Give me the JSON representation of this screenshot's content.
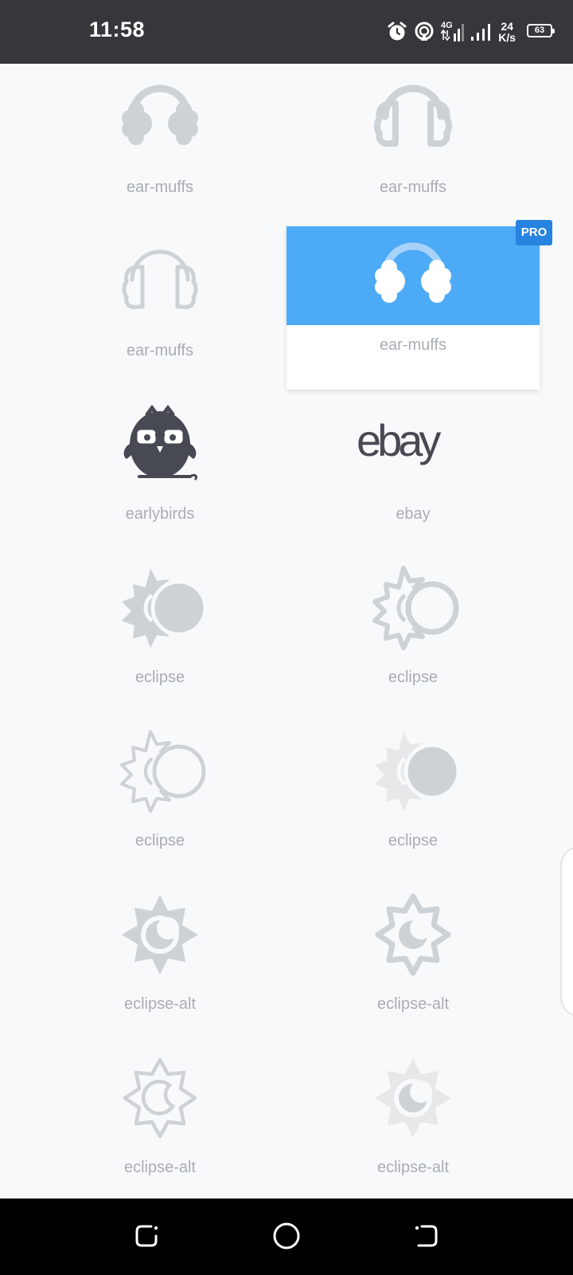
{
  "status_bar": {
    "time": "11:58",
    "net_speed_value": "24",
    "net_speed_unit": "K/s",
    "network_type": "4G",
    "battery": "63",
    "icons": [
      "alarm-icon",
      "hotspot-icon",
      "signal-4g-icon",
      "signal-icon",
      "battery-icon"
    ]
  },
  "grid": {
    "items": [
      {
        "label": "ear-muffs",
        "icon": "ear-muffs-solid-icon"
      },
      {
        "label": "ear-muffs",
        "icon": "ear-muffs-outline-icon"
      },
      {
        "label": "ear-muffs",
        "icon": "ear-muffs-light-icon"
      },
      {
        "label": "ear-muffs",
        "icon": "ear-muffs-duotone-icon",
        "selected": true,
        "badge": "PRO"
      },
      {
        "label": "earlybirds",
        "icon": "earlybirds-owl-icon"
      },
      {
        "label": "ebay",
        "icon": "ebay-logo-icon",
        "logo_text": "ebay"
      },
      {
        "label": "eclipse",
        "icon": "eclipse-solid-icon"
      },
      {
        "label": "eclipse",
        "icon": "eclipse-outline-icon"
      },
      {
        "label": "eclipse",
        "icon": "eclipse-light-icon"
      },
      {
        "label": "eclipse",
        "icon": "eclipse-duotone-icon"
      },
      {
        "label": "eclipse-alt",
        "icon": "eclipse-alt-solid-icon"
      },
      {
        "label": "eclipse-alt",
        "icon": "eclipse-alt-outline-icon"
      },
      {
        "label": "eclipse-alt",
        "icon": "eclipse-alt-light-icon"
      },
      {
        "label": "eclipse-alt",
        "icon": "eclipse-alt-duotone-icon"
      }
    ]
  },
  "nav_bar": {
    "icons": [
      "recent-apps-icon",
      "home-icon",
      "back-icon"
    ]
  },
  "colors": {
    "status_bar_bg": "#36373b",
    "page_bg": "#f7f9fa",
    "icon_gray": "#cdd2d7",
    "icon_light_gray": "#e6e8ea",
    "icon_dark": "#474a53",
    "selected_blue": "#4daaf6",
    "pro_badge": "#2684e0",
    "label_gray": "#a9aeb3"
  }
}
